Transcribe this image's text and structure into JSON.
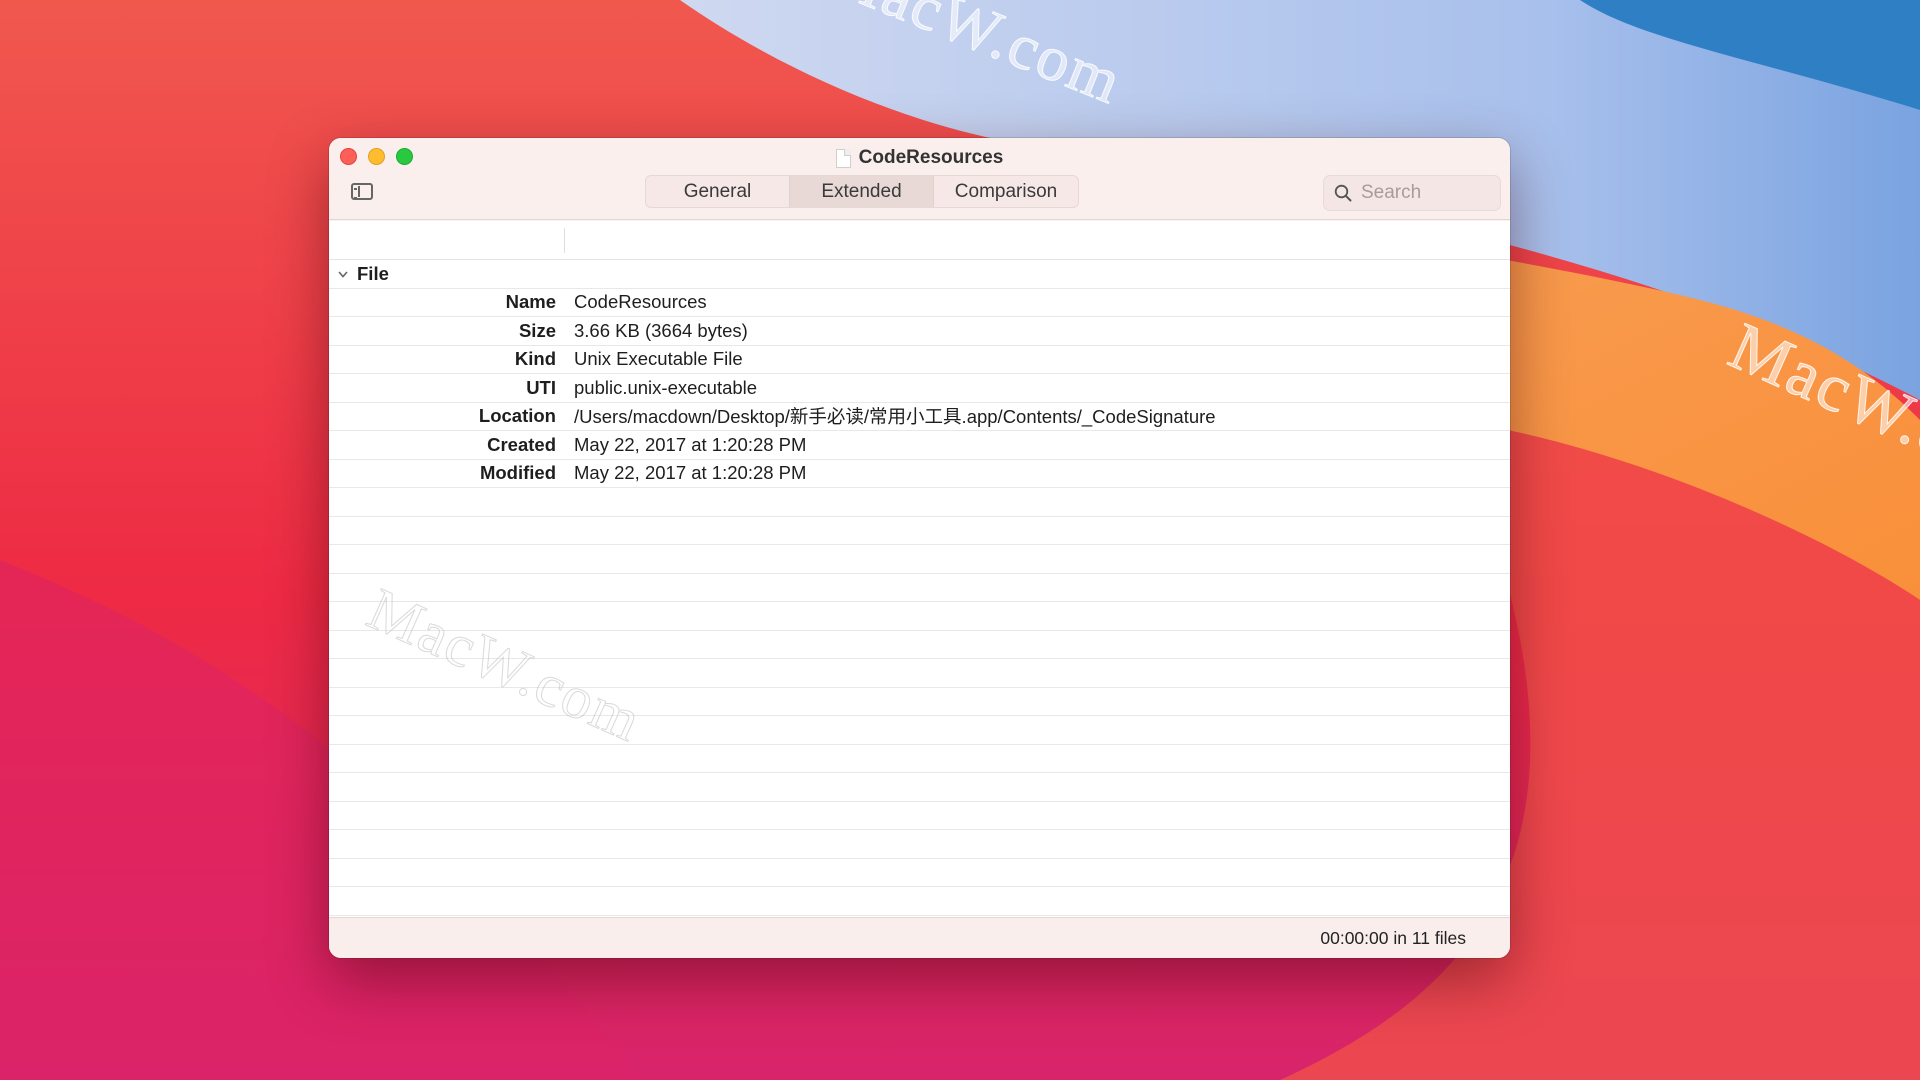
{
  "window": {
    "title": "CodeResources",
    "tabs": [
      {
        "label": "General",
        "active": false
      },
      {
        "label": "Extended",
        "active": true
      },
      {
        "label": "Comparison",
        "active": false
      }
    ],
    "search": {
      "placeholder": "Search",
      "value": ""
    }
  },
  "group": {
    "label": "File",
    "expanded": true
  },
  "properties": [
    {
      "key": "Name",
      "value": "CodeResources"
    },
    {
      "key": "Size",
      "value": "3.66 KB (3664 bytes)"
    },
    {
      "key": "Kind",
      "value": "Unix Executable File"
    },
    {
      "key": "UTI",
      "value": "public.unix-executable"
    },
    {
      "key": "Location",
      "value": "/Users/macdown/Desktop/新手必读/常用小工具.app/Contents/_CodeSignature"
    },
    {
      "key": "Created",
      "value": "May 22, 2017 at 1:20:28 PM"
    },
    {
      "key": "Modified",
      "value": "May 22, 2017 at 1:20:28 PM"
    }
  ],
  "status": {
    "text": "00:00:00 in 11 files"
  },
  "watermark": "MacW.com",
  "icons": {
    "sidebar": "sidebar-toggle-icon",
    "search": "magnifier-icon",
    "disclosure": "chevron-down-icon",
    "document": "document-icon"
  },
  "colors": {
    "close": "#fe5f57",
    "minimize": "#febc2e",
    "maximize": "#28c840",
    "window_bg": "#fbf1f0"
  }
}
